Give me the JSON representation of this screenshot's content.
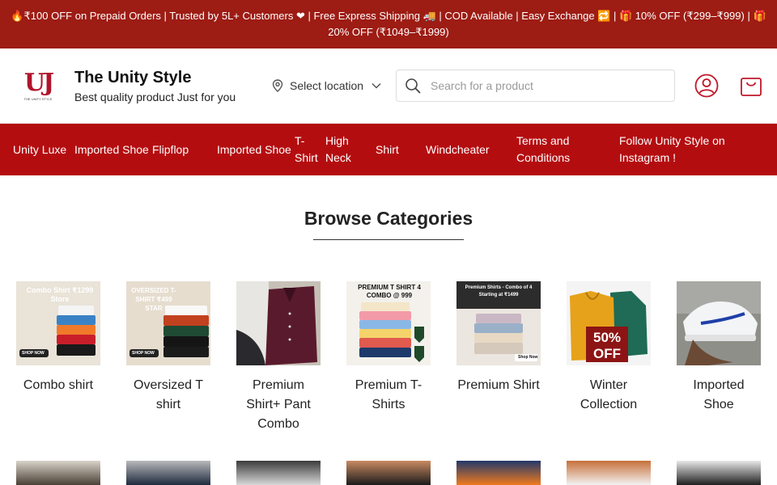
{
  "announcement": {
    "text": "🔥₹100 OFF on Prepaid Orders | Trusted by 5L+ Customers ❤ | Free Express Shipping 🚚 | COD Available | Easy Exchange 🔁 | 🎁 10% OFF (₹299–₹999) | 🎁 20% OFF (₹1049–₹1999)"
  },
  "header": {
    "logo_text": "THE UNITY STYLE",
    "brand_name": "The Unity Style",
    "tagline": "Best quality product Just for you",
    "location_label": "Select location",
    "search_placeholder": "Search for a product"
  },
  "nav": {
    "items": [
      {
        "label": "Unity Luxe"
      },
      {
        "label": "Imported Shoe"
      },
      {
        "label": "Flipflop"
      },
      {
        "label": "Imported Shoe"
      },
      {
        "label": "T-Shirt"
      },
      {
        "label": "High Neck"
      },
      {
        "label": "Shirt"
      },
      {
        "label": "Windcheater"
      },
      {
        "label": "Terms and Conditions"
      },
      {
        "label": "Follow Unity Style on Instagram !"
      }
    ]
  },
  "main": {
    "section_title": "Browse Categories",
    "categories": [
      {
        "label": "Combo shirt",
        "badge": "Combo Shirt ₹1299 Store",
        "cta": "SHOP NOW"
      },
      {
        "label": "Oversized T shirt",
        "badge": "OVERSIZED T-SHIRT ₹499 STAR",
        "cta": "SHOP NOW"
      },
      {
        "label": "Premium Shirt+ Pant Combo"
      },
      {
        "label": "Premium T-Shirts",
        "badge": "PREMIUM T SHIRT 4 COMBO @ 999"
      },
      {
        "label": "Premium Shirt",
        "badge": "Premium Shirts - Combo of 4 Starting at ₹1499",
        "cta": "Shop Now"
      },
      {
        "label": "Winter Collection",
        "badge": "50% OFF"
      },
      {
        "label": "Imported Shoe"
      }
    ]
  },
  "colors": {
    "announce_bg": "#9d1c14",
    "nav_bg": "#b40d10",
    "brand_accent": "#b0152c"
  }
}
